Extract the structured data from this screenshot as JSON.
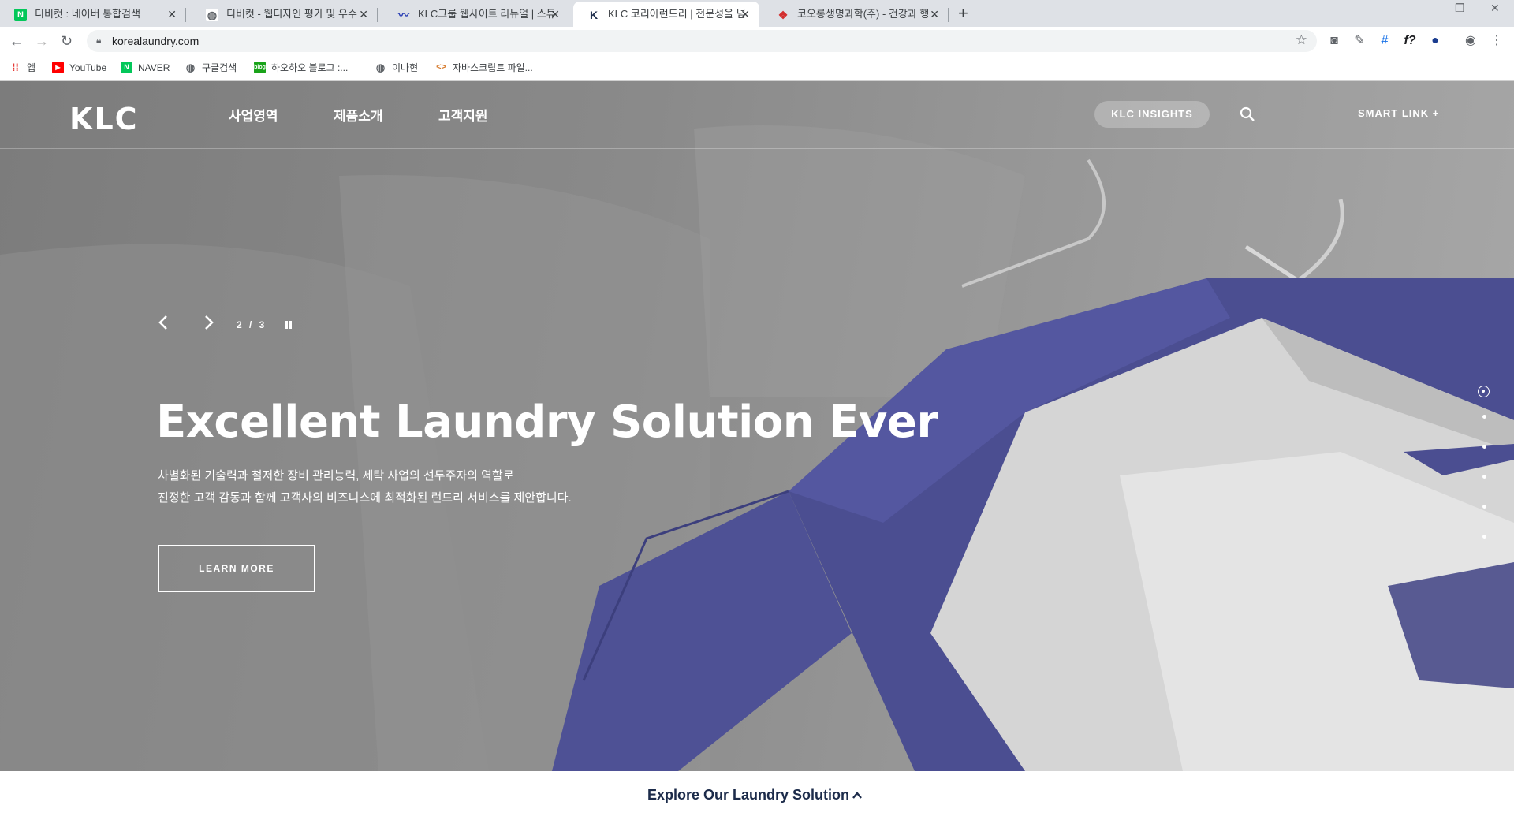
{
  "browser": {
    "tabs": [
      {
        "title": "디비컷 : 네이버 통합검색",
        "favicon": "naver-icon",
        "active": false
      },
      {
        "title": "디비컷 - 웹디자인 평가 및 우수",
        "favicon": "globe-icon",
        "active": false
      },
      {
        "title": "KLC그룹 웹사이트 리뉴얼 | 스튜",
        "favicon": "wave-icon",
        "active": false
      },
      {
        "title": "KLC 코리아런드리 | 전문성을 넘",
        "favicon": "klc-icon",
        "active": true
      },
      {
        "title": "코오롱생명과학(주) - 건강과 행",
        "favicon": "kolon-icon",
        "active": false
      }
    ],
    "url": "korealaundry.com",
    "bookmarks": [
      {
        "label": "앱",
        "icon": "apps-grid-icon"
      },
      {
        "label": "YouTube",
        "icon": "youtube-icon"
      },
      {
        "label": "NAVER",
        "icon": "naver-icon"
      },
      {
        "label": "구글검색",
        "icon": "globe-icon"
      },
      {
        "label": "하오하오 블로그 :...",
        "icon": "blog-icon"
      },
      {
        "label": "이나현",
        "icon": "globe-icon"
      },
      {
        "label": "자바스크립트 파일...",
        "icon": "code-icon"
      }
    ]
  },
  "site": {
    "logo": "KLC",
    "nav": [
      "사업영역",
      "제품소개",
      "고객지원"
    ],
    "insights_label": "KLC INSIGHTS",
    "smart_link_label": "SMART LINK +",
    "slider": {
      "counter": "2 / 3"
    },
    "hero": {
      "headline": "Excellent Laundry Solution Ever",
      "desc_line1": "차별화된 기술력과 철저한 장비 관리능력, 세탁 사업의 선두주자의 역할로",
      "desc_line2": "진정한 고객 감동과 함께 고객사의 비즈니스에 최적화된 런드리 서비스를 제안합니다.",
      "button": "LEARN MORE"
    },
    "pagination_dots": 6,
    "active_dot": 0,
    "explore_label": "Explore Our Laundry Solution"
  },
  "colors": {
    "accent_shirt": "#4b4e91",
    "explore_text": "#1c2b4a"
  }
}
